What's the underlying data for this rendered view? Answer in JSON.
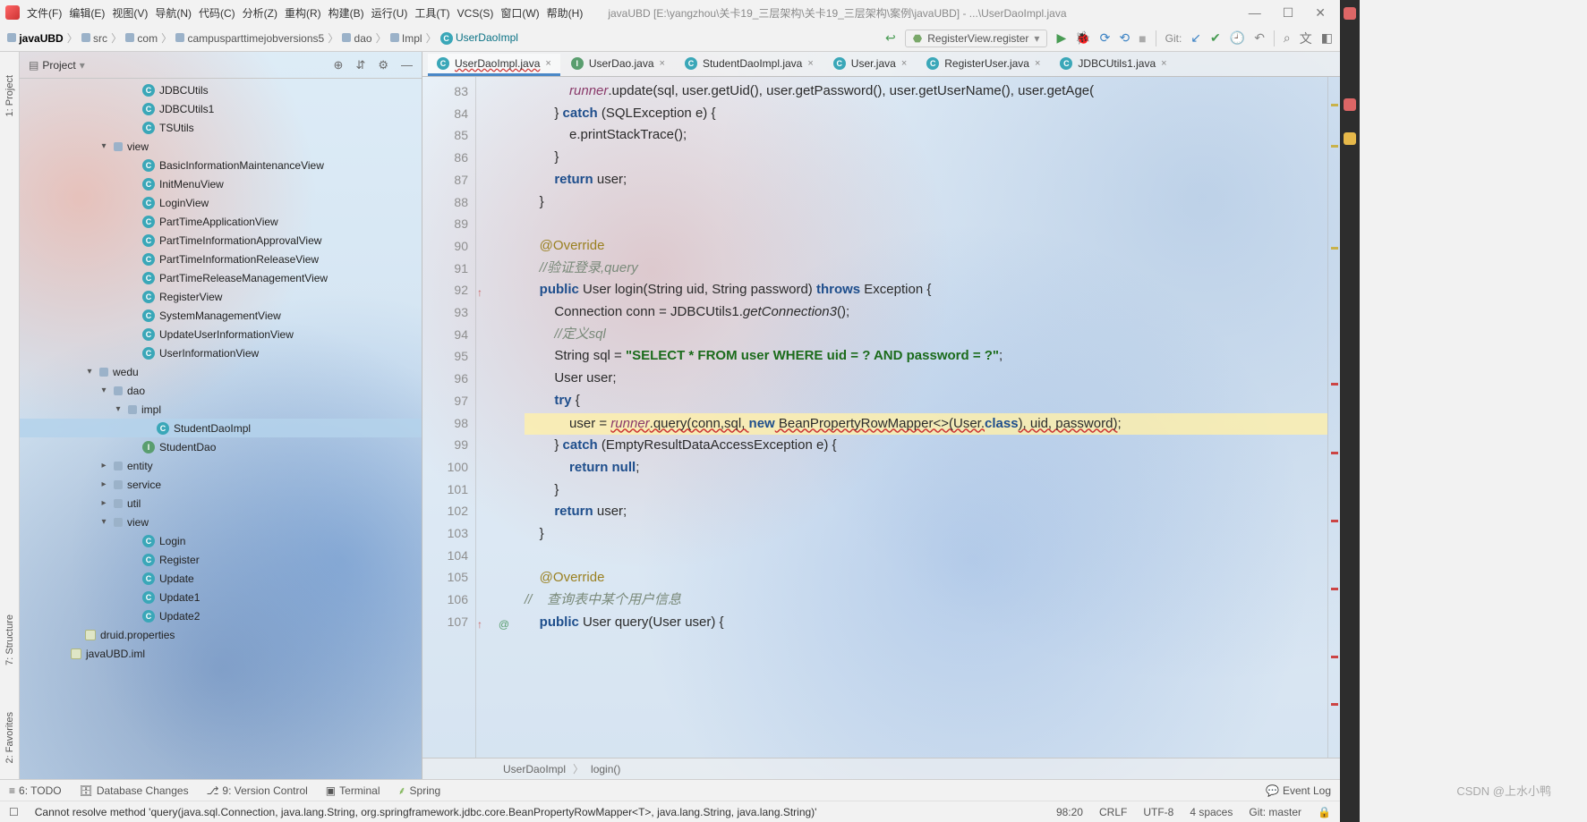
{
  "window": {
    "title": "javaUBD [E:\\yangzhou\\关卡19_三层架构\\关卡19_三层架构\\案例\\javaUBD] - ...\\UserDaoImpl.java"
  },
  "menu": [
    "文件(F)",
    "编辑(E)",
    "视图(V)",
    "导航(N)",
    "代码(C)",
    "分析(Z)",
    "重构(R)",
    "构建(B)",
    "运行(U)",
    "工具(T)",
    "VCS(S)",
    "窗口(W)",
    "帮助(H)"
  ],
  "breadcrumbs": {
    "project": "javaUBD",
    "parts": [
      "src",
      "com",
      "campusparttimejobversions5",
      "dao",
      "Impl"
    ],
    "class": "UserDaoImpl"
  },
  "runwidget": {
    "selected": "RegisterView.register",
    "git_label": "Git:"
  },
  "project_panel": {
    "title": "Project",
    "tree": [
      {
        "depth": 7,
        "icon": "c",
        "label": "JDBCUtils"
      },
      {
        "depth": 7,
        "icon": "c",
        "label": "JDBCUtils1"
      },
      {
        "depth": 7,
        "icon": "c",
        "label": "TSUtils"
      },
      {
        "depth": 5,
        "arrow": "▾",
        "icon": "fld",
        "label": "view"
      },
      {
        "depth": 7,
        "icon": "c",
        "label": "BasicInformationMaintenanceView"
      },
      {
        "depth": 7,
        "icon": "c",
        "label": "InitMenuView"
      },
      {
        "depth": 7,
        "icon": "c",
        "label": "LoginView"
      },
      {
        "depth": 7,
        "icon": "c",
        "label": "PartTimeApplicationView"
      },
      {
        "depth": 7,
        "icon": "c",
        "label": "PartTimeInformationApprovalView"
      },
      {
        "depth": 7,
        "icon": "c",
        "label": "PartTimeInformationReleaseView"
      },
      {
        "depth": 7,
        "icon": "c",
        "label": "PartTimeReleaseManagementView"
      },
      {
        "depth": 7,
        "icon": "c",
        "label": "RegisterView"
      },
      {
        "depth": 7,
        "icon": "c",
        "label": "SystemManagementView"
      },
      {
        "depth": 7,
        "icon": "c",
        "label": "UpdateUserInformationView"
      },
      {
        "depth": 7,
        "icon": "c",
        "label": "UserInformationView"
      },
      {
        "depth": 4,
        "arrow": "▾",
        "icon": "fld",
        "label": "wedu"
      },
      {
        "depth": 5,
        "arrow": "▾",
        "icon": "fld",
        "label": "dao"
      },
      {
        "depth": 6,
        "arrow": "▾",
        "icon": "fld",
        "label": "impl"
      },
      {
        "depth": 8,
        "icon": "c",
        "label": "StudentDaoImpl",
        "sel": true
      },
      {
        "depth": 7,
        "icon": "i",
        "label": "StudentDao"
      },
      {
        "depth": 5,
        "arrow": "▸",
        "icon": "fld",
        "label": "entity"
      },
      {
        "depth": 5,
        "arrow": "▸",
        "icon": "fld",
        "label": "service"
      },
      {
        "depth": 5,
        "arrow": "▸",
        "icon": "fld",
        "label": "util"
      },
      {
        "depth": 5,
        "arrow": "▾",
        "icon": "fld",
        "label": "view"
      },
      {
        "depth": 7,
        "icon": "c",
        "label": "Login"
      },
      {
        "depth": 7,
        "icon": "c",
        "label": "Register"
      },
      {
        "depth": 7,
        "icon": "c",
        "label": "Update"
      },
      {
        "depth": 7,
        "icon": "c",
        "label": "Update1"
      },
      {
        "depth": 7,
        "icon": "c",
        "label": "Update2"
      },
      {
        "depth": 3,
        "icon": "file",
        "label": "druid.properties"
      },
      {
        "depth": 2,
        "icon": "file",
        "label": "javaUBD.iml"
      }
    ]
  },
  "leftgutter": [
    {
      "label": "1: Project"
    },
    {
      "label": "7: Structure"
    },
    {
      "label": "2: Favorites"
    }
  ],
  "editor_tabs": [
    {
      "icon": "c",
      "label": "UserDaoImpl.java",
      "active": true,
      "wavy": true
    },
    {
      "icon": "i",
      "label": "UserDao.java"
    },
    {
      "icon": "c",
      "label": "StudentDaoImpl.java"
    },
    {
      "icon": "c",
      "label": "User.java"
    },
    {
      "icon": "c",
      "label": "RegisterUser.java"
    },
    {
      "icon": "c",
      "label": "JDBCUtils1.java"
    }
  ],
  "code": {
    "start": 83,
    "lines": [
      {
        "n": 83,
        "html": "            <span class='fld2'>runner</span>.update(sql, user.getUid(), user.getPassword(), user.getUserName(), user.getAge("
      },
      {
        "n": 84,
        "html": "        } <span class='kw'>catch</span> (SQLException e) {"
      },
      {
        "n": 85,
        "html": "            e.printStackTrace();"
      },
      {
        "n": 86,
        "html": "        }"
      },
      {
        "n": 87,
        "html": "        <span class='kw'>return</span> user;"
      },
      {
        "n": 88,
        "html": "    }"
      },
      {
        "n": 89,
        "html": ""
      },
      {
        "n": 90,
        "html": "    <span class='ann'>@Override</span>"
      },
      {
        "n": 91,
        "html": "    <span class='cmt'>//验证登录,query</span>"
      },
      {
        "n": 92,
        "up": true,
        "html": "    <span class='kw'>public</span> User login(String uid, String password) <span class='kw'>throws</span> Exception {"
      },
      {
        "n": 93,
        "html": "        Connection conn = JDBCUtils1.<span class='stat'>getConnection3</span>();"
      },
      {
        "n": 94,
        "html": "        <span class='cmt'>//定义sql</span>"
      },
      {
        "n": 95,
        "html": "        String sql = <span class='str'>\"SELECT * FROM user WHERE uid = ? AND password = ?\"</span>;"
      },
      {
        "n": 96,
        "html": "        User user;"
      },
      {
        "n": 97,
        "html": "        <span class='kw'>try</span> {"
      },
      {
        "n": 98,
        "hl": true,
        "html": "            user = <span class='fld2 redw'>runner</span><span class='redw'>.query(conn,sql, </span><span class='kw'>new</span><span class='redw'> BeanPropertyRowMapper&lt;&gt;(User.</span><span class='kw'>class</span><span class='redw'>), uid, password)</span>;"
      },
      {
        "n": 99,
        "html": "        } <span class='kw'>catch</span> (EmptyResultDataAccessException e) {"
      },
      {
        "n": 100,
        "html": "            <span class='kw'>return null</span>;"
      },
      {
        "n": 101,
        "html": "        }"
      },
      {
        "n": 102,
        "html": "        <span class='kw'>return</span> user;"
      },
      {
        "n": 103,
        "html": "    }"
      },
      {
        "n": 104,
        "html": ""
      },
      {
        "n": 105,
        "html": "    <span class='ann'>@Override</span>"
      },
      {
        "n": 106,
        "html": "<span class='cmt'>//    查询表中某个用户信息</span>"
      },
      {
        "n": 107,
        "up": true,
        "ov": true,
        "html": "    <span class='kw'>public</span> User query(User user) {"
      }
    ]
  },
  "editor_crumb": {
    "class": "UserDaoImpl",
    "method": "login()"
  },
  "bottom_tools": [
    "6: TODO",
    "Database Changes",
    "9: Version Control",
    "Terminal",
    "Spring"
  ],
  "event_log": "Event Log",
  "status": {
    "msg": "Cannot resolve method 'query(java.sql.Connection, java.lang.String, org.springframework.jdbc.core.BeanPropertyRowMapper<T>, java.lang.String, java.lang.String)'",
    "pos": "98:20",
    "eol": "CRLF",
    "enc": "UTF-8",
    "indent": "4 spaces",
    "git": "Git: master"
  },
  "watermark": "CSDN @上水小鸭"
}
